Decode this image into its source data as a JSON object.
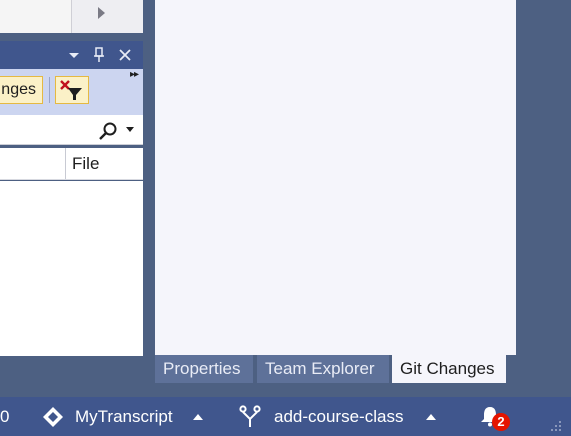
{
  "left_panel": {
    "filter_button_label": "nges",
    "search_placeholder": "",
    "column_file": "File"
  },
  "tool_tabs": [
    {
      "label": "Properties"
    },
    {
      "label": "Team Explorer"
    },
    {
      "label": "Git Changes"
    }
  ],
  "status_bar": {
    "left_number": "0",
    "repository": "MyTranscript",
    "branch": "add-course-class",
    "notification_count": "2"
  },
  "colors": {
    "background": "#4d6082",
    "statusbar": "#40568d",
    "accent_badge": "#e51400"
  }
}
